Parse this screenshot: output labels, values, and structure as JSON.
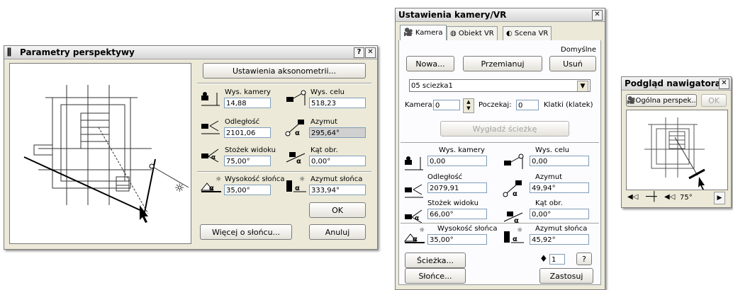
{
  "win1": {
    "title": "Parametry perspektywy",
    "help": "?",
    "close": "✕",
    "axon_button": "Ustawienia aksonometrii...",
    "cam_height_label": "Wys. kamery",
    "cam_height_value": "14,88",
    "target_height_label": "Wys. celu",
    "target_height_value": "518,23",
    "distance_label": "Odległość",
    "distance_value": "2101,06",
    "azimuth_label": "Azymut",
    "azimuth_value": "295,64°",
    "cone_label": "Stożek widoku",
    "cone_value": "75,00°",
    "roll_label": "Kąt obr.",
    "roll_value": "0,00°",
    "sun_alt_label": "Wysokość słońca",
    "sun_alt_value": "35,00°",
    "sun_az_label": "Azymut słońca",
    "sun_az_value": "333,94°",
    "ok": "OK",
    "more_sun": "Więcej o słońcu...",
    "cancel": "Anuluj"
  },
  "win2": {
    "title": "Ustawienia kamery/VR",
    "close": "✕",
    "tabs": [
      "Kamera",
      "Obiekt VR",
      "Scena VR"
    ],
    "default_label": "Domyślne",
    "new": "Nowa...",
    "rename": "Przemianuj",
    "delete": "Usuń",
    "path_select": "05 sciezka1",
    "camera_label": "Kamera:",
    "camera_value": "0",
    "start_label": "Poczekaj:",
    "start_value": "0",
    "frames_label": "Klatki (klatek)",
    "smooth": "Wygładź ścieżkę",
    "cam_height_label": "Wys. kamery",
    "cam_height_value": "0,00",
    "target_height_label": "Wys. celu",
    "target_height_value": "0,00",
    "distance_label": "Odległość",
    "distance_value": "2079,91",
    "azimuth_label": "Azymut",
    "azimuth_value": "49,94°",
    "cone_label": "Stożek widoku",
    "cone_value": "66,00°",
    "roll_label": "Kąt obr.",
    "roll_value": "0,00°",
    "sun_alt_label": "Wysokość słońca",
    "sun_alt_value": "35,00°",
    "sun_az_label": "Azymut słońca",
    "sun_az_value": "45,92°",
    "path_btn": "Ścieżka...",
    "counter_value": "1",
    "help": "?",
    "sun_btn": "Słońce...",
    "apply": "Zastosuj"
  },
  "win3": {
    "title": "Podgląd nawigatora",
    "close": "✕",
    "view_btn": "Ogólna perspek...",
    "ok": "OK",
    "angle": "75°"
  }
}
